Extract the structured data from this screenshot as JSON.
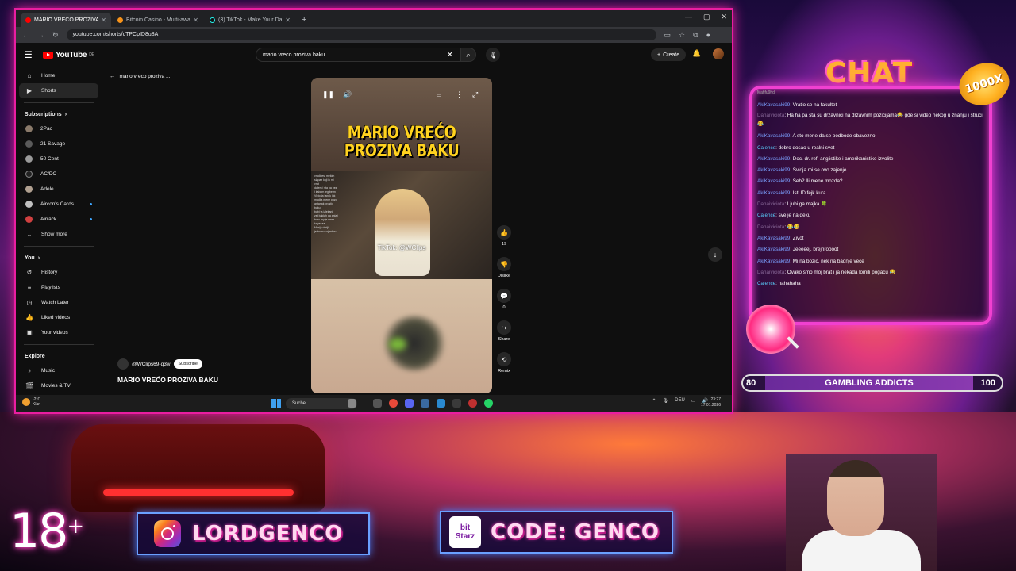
{
  "browser": {
    "tabs": [
      {
        "label": "MARIO VREĆO PROZIVA B...",
        "active": true
      },
      {
        "label": "Bitcoin Casino - Multi-award W...",
        "active": false
      },
      {
        "label": "(3) TikTok - Make Your Day",
        "active": false
      }
    ],
    "new_tab": "+",
    "url": "youtube.com/shorts/cTPCpID8u8A"
  },
  "youtube": {
    "logo": "YouTube",
    "logo_region": "DE",
    "search_query": "mario vreco proziva baku",
    "create_label": "Create",
    "sidebar": {
      "main": [
        {
          "label": "Home",
          "icon": "home-icon"
        },
        {
          "label": "Shorts",
          "icon": "shorts-icon",
          "active": true
        }
      ],
      "subscriptions_title": "Subscriptions",
      "subscriptions": [
        {
          "label": "2Pac",
          "new": false
        },
        {
          "label": "21 Savage",
          "new": false
        },
        {
          "label": "50 Cent",
          "new": false
        },
        {
          "label": "AC/DC",
          "new": false
        },
        {
          "label": "Adele",
          "new": false
        },
        {
          "label": "Aircon's Cards",
          "new": true
        },
        {
          "label": "Airrack",
          "new": true
        }
      ],
      "show_more": "Show more",
      "you_title": "You",
      "you": [
        {
          "label": "History",
          "icon": "history-icon"
        },
        {
          "label": "Playlists",
          "icon": "playlists-icon"
        },
        {
          "label": "Watch Later",
          "icon": "watch-later-icon"
        },
        {
          "label": "Liked videos",
          "icon": "thumbs-up-icon"
        },
        {
          "label": "Your videos",
          "icon": "your-videos-icon"
        }
      ],
      "explore_title": "Explore",
      "explore": [
        {
          "label": "Music",
          "icon": "music-icon"
        },
        {
          "label": "Movies & TV",
          "icon": "movies-icon"
        }
      ]
    },
    "breadcrumb": "mario vreco proziva ...",
    "video": {
      "overlay_title_line1": "MARIO VREĆO",
      "overlay_title_line2": "PROZIVA BAKU",
      "handle_watermark": "TikTok: @WClips",
      "chat_snippet": "vradicest mekim\nslapaz kuji ik mi\nvrat\ndalem i sta na bez\ni kabom leg berm\nVictoria janek lok\nmadija mene pozo\nantanak prostiv\nbaku\nbabi ta izlekani\nzet baklah da anjali\nbaro my je smer\nkayaaaa\nMarija dodji\njednom u njenkov"
    },
    "actions": [
      {
        "icon": "thumbs-up-icon",
        "label": "19"
      },
      {
        "icon": "thumbs-down-icon",
        "label": "Dislike"
      },
      {
        "icon": "comment-icon",
        "label": "0"
      },
      {
        "icon": "share-icon",
        "label": "Share"
      },
      {
        "icon": "remix-icon",
        "label": "Remix"
      }
    ],
    "channel_handle": "@WClips69-q3w",
    "subscribe_label": "Subscribe",
    "short_title": "MARIO VREĆO PROZIVA BAKU"
  },
  "taskbar": {
    "weather_temp": "-2°C",
    "weather_desc": "Klar",
    "search_placeholder": "Suche",
    "lang": "DEU",
    "time": "23:27",
    "date": "17.01.2026"
  },
  "overlay": {
    "chat_title": "CHAT",
    "multiplier_badge": "1000X",
    "chat_header_user": "Mafifu9hd",
    "chat_messages": [
      {
        "user": "AkiKavasaki99",
        "text": ": Vratio se na fakultet",
        "style": "c1"
      },
      {
        "user": "Danaiviciota",
        "text": ": Ha ha pa sta su drzavnici na drzavnim pozicijama😂 gde si video nekog u znanju i struci 😂",
        "style": "c2",
        "wrap": true
      },
      {
        "user": "AkiKavasaki99",
        "text": ": A sto mene da se podbode obavezno",
        "style": "c1"
      },
      {
        "user": "Calence",
        "text": ": dobro dosao u realni svet",
        "style": "c3"
      },
      {
        "user": "AkiKavasaki99",
        "text": ": Doc. dr. ref. anglistike i amerikanistike izvolite",
        "style": "c1"
      },
      {
        "user": "AkiKavasaki99",
        "text": ": Svidja mi se ovo zajenje",
        "style": "c1"
      },
      {
        "user": "AkiKavasaki99",
        "text": ": Seb? Ili mene mozda?",
        "style": "c1"
      },
      {
        "user": "AkiKavasaki99",
        "text": ": Isti ID fejk kura",
        "style": "c1"
      },
      {
        "user": "Danaiviciota",
        "text": ": Ljubi ga majka 🍀",
        "style": "c2"
      },
      {
        "user": "Calence",
        "text": ": sve je na deku",
        "style": "c3"
      },
      {
        "user": "Danaiviciota",
        "text": ": 😂😂",
        "style": "c2"
      },
      {
        "user": "AkiKavasaki99",
        "text": ": Zivot",
        "style": "c1"
      },
      {
        "user": "AkiKavasaki99",
        "text": ": Jeeeeej, brejnroooot",
        "style": "c1"
      },
      {
        "user": "AkiKavasaki99",
        "text": ": Mi na bozic, nek na badnje vece",
        "style": "c1"
      },
      {
        "user": "Danaiviciota",
        "text": ": Ovako smo moj brat i ja nekada lomili pogacu 😂",
        "style": "c2"
      },
      {
        "user": "Calence",
        "text": ": hahahaha",
        "style": "c3"
      }
    ],
    "bar_left": "80",
    "bar_label": "GAMBLING ADDICTS",
    "bar_right": "100",
    "age_label": "18",
    "age_plus": "+",
    "instagram_handle": "LORDGENCO",
    "bitstarz_top": "bit",
    "bitstarz_bottom": "Starz",
    "code_label": "CODE: GENCO"
  }
}
